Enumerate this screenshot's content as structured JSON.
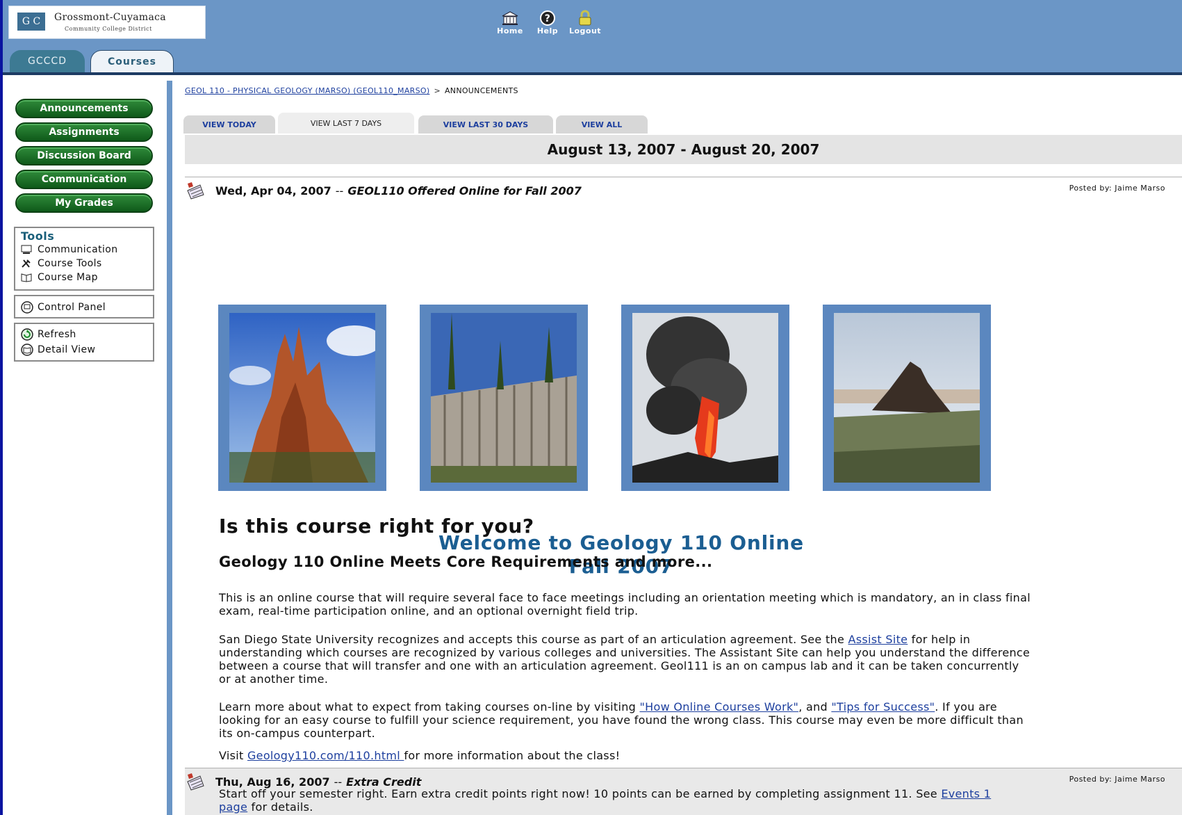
{
  "header": {
    "logo_mark": "G C",
    "logo_line1": "Grossmont-Cuyamaca",
    "logo_line2": "Community College District",
    "nav": [
      {
        "label": "Home",
        "icon": "home-icon"
      },
      {
        "label": "Help",
        "icon": "help-icon"
      },
      {
        "label": "Logout",
        "icon": "lock-icon"
      }
    ],
    "tabs": [
      {
        "label": "GCCCD",
        "selected": false
      },
      {
        "label": "Courses",
        "selected": true
      }
    ]
  },
  "sidebar": {
    "buttons": [
      "Announcements",
      "Assignments",
      "Discussion Board",
      "Communication",
      "My Grades"
    ],
    "tools_title": "Tools",
    "tools": [
      "Communication",
      "Course Tools",
      "Course Map"
    ],
    "control_panel": "Control Panel",
    "refresh": "Refresh",
    "detail_view": "Detail View"
  },
  "breadcrumb": {
    "course_link": "GEOL 110 - PHYSICAL GEOLOGY (MARSO) (GEOL110_MARSO)",
    "separator": ">",
    "current": "ANNOUNCEMENTS"
  },
  "view_tabs": [
    {
      "label": "VIEW TODAY",
      "selected": false
    },
    {
      "label": "VIEW LAST 7 DAYS",
      "selected": true
    },
    {
      "label": "VIEW LAST 30 DAYS",
      "selected": false
    },
    {
      "label": "VIEW ALL",
      "selected": false
    }
  ],
  "date_range": "August 13, 2007 - August 20, 2007",
  "announcement1": {
    "date": "Wed, Apr 04, 2007",
    "dash": "--",
    "title": "GEOL110 Offered Online for Fall 2007",
    "posted_by": "Posted by: Jaime Marso",
    "welcome_line1": "Welcome to Geology 110 Online",
    "welcome_line2": "Fall 2007",
    "heading": "Is this course right for you?",
    "subheading": "Geology 110 Online Meets Core Requirements and more...",
    "p1": "This is an online course that will require several face to face meetings including an orientation meeting which is mandatory, an in class final exam, real-time participation online, and an optional overnight field trip.",
    "p2_before": "San Diego State University recognizes and accepts this course as part of an articulation agreement. See the ",
    "p2_link": "Assist Site",
    "p2_after": " for help in understanding which courses are recognized by various colleges and universities. The Assistant Site can help you understand the difference between a course that will transfer and one with an articulation agreement. Geol111 is an on campus lab and it can be taken concurrently or at another time.",
    "p3_before": "Learn more about what to expect from taking courses on-line by visiting ",
    "p3_link1": "\"How Online Courses Work\"",
    "p3_mid": ", and ",
    "p3_link2": "\"Tips for Success\"",
    "p3_after": ".   If you are looking for an easy course to fulfill your science requirement, you have found the wrong class. This course may even be more difficult than its on-campus counterpart.",
    "p4_before": "Visit ",
    "p4_link": "Geology110.com/110.html ",
    "p4_after": " for more information about the class!"
  },
  "announcement2": {
    "date": "Thu, Aug 16, 2007",
    "dash": "--",
    "title": "Extra Credit",
    "posted_by": "Posted by: Jaime Marso",
    "text_before": "Start off your semester right.  Earn extra credit points right now! 10 points can be earned by completing assignment 11.  See ",
    "link": "Events 1 page",
    "text_after": " for details."
  },
  "colors": {
    "header_bg": "#6b96c6",
    "menu_green": "#1b6e26",
    "welcome_blue": "#1b5e92",
    "link_blue": "#1d3f9e"
  }
}
